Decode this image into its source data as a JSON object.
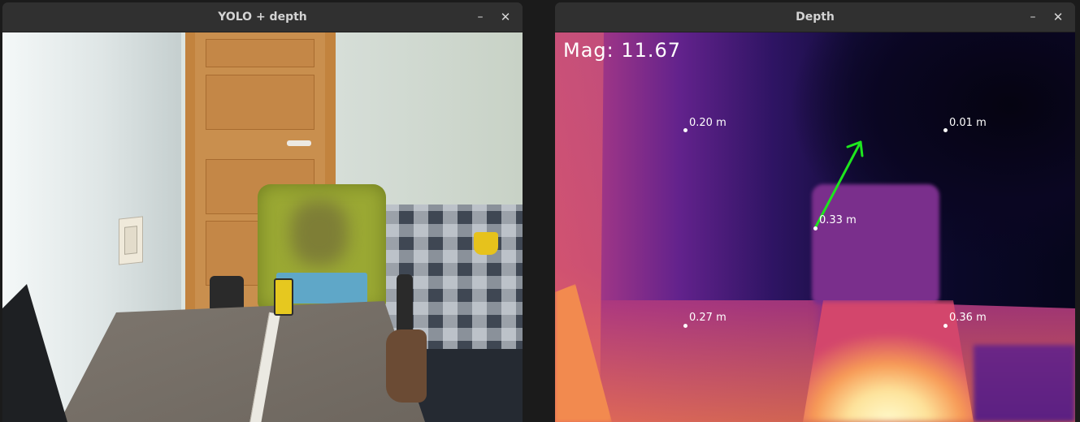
{
  "left_window": {
    "title": "YOLO + depth",
    "minimize_label": "–",
    "close_label": "✕"
  },
  "right_window": {
    "title": "Depth",
    "minimize_label": "–",
    "close_label": "✕",
    "magnitude_text": "Mag: 11.67",
    "depth_points": [
      {
        "label": "0.20 m"
      },
      {
        "label": "0.01 m"
      },
      {
        "label": "0.33 m"
      },
      {
        "label": "0.27 m"
      },
      {
        "label": "0.36 m"
      }
    ],
    "vector_color": "#1ee61e"
  }
}
